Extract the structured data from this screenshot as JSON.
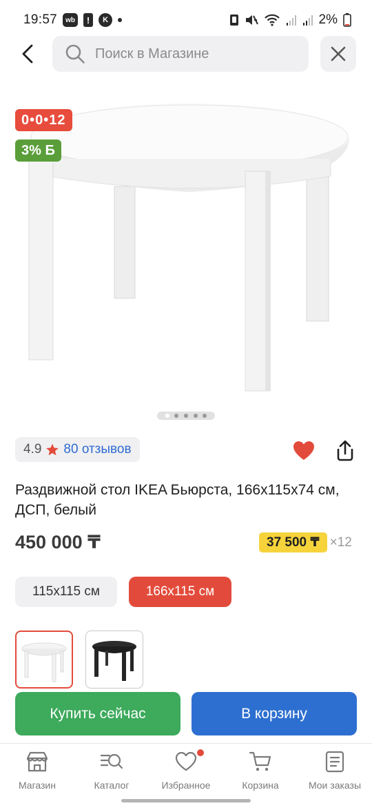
{
  "status_bar": {
    "time": "19:57",
    "battery": "2%",
    "wb_label": "wb",
    "alert_label": "!",
    "k_label": "K"
  },
  "header": {
    "search_placeholder": "Поиск в Магазине"
  },
  "gallery": {
    "installment_badge": "0•0•12",
    "bonus_badge": "3% Б",
    "slide_count": 5,
    "active_slide": 1
  },
  "product": {
    "rating": "4.9",
    "reviews": "80 отзывов",
    "title": "Раздвижной стол IKEA Бьюрста, 166х115х74 см, ДСП, белый",
    "price": "450 000 ₸",
    "monthly_amount": "37 500 ₸",
    "monthly_multiplier": "×12",
    "sizes": [
      {
        "label": "115x115 см",
        "selected": false
      },
      {
        "label": "166x115 см",
        "selected": true
      }
    ],
    "variants": [
      {
        "name": "white",
        "selected": true
      },
      {
        "name": "black",
        "selected": false
      }
    ]
  },
  "actions": {
    "buy_now": "Купить сейчас",
    "add_to_cart": "В корзину"
  },
  "nav": {
    "items": [
      {
        "label": "Магазин",
        "icon": "store-icon"
      },
      {
        "label": "Каталог",
        "icon": "catalog-search-icon"
      },
      {
        "label": "Избранное",
        "icon": "heart-outline-icon"
      },
      {
        "label": "Корзина",
        "icon": "cart-icon"
      },
      {
        "label": "Мои заказы",
        "icon": "orders-icon"
      }
    ]
  },
  "colors": {
    "accent_red": "#e24b3b",
    "buy_green": "#3daa5c",
    "cart_blue": "#2d6fd0",
    "price_yellow": "#f6d33b",
    "bonus_green": "#5a9e3a",
    "link_blue": "#2f6bd1"
  }
}
